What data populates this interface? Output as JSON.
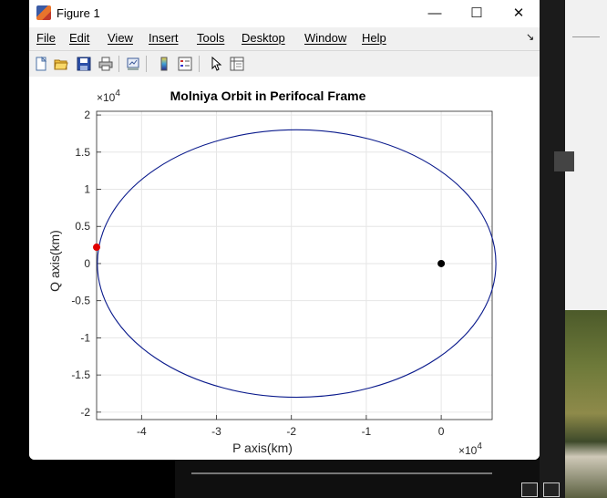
{
  "window": {
    "title": "Figure 1",
    "controls": {
      "minimize": "—",
      "maximize": "☐",
      "close": "✕"
    }
  },
  "menu": {
    "items": [
      "File",
      "Edit",
      "View",
      "Insert",
      "Tools",
      "Desktop",
      "Window",
      "Help"
    ],
    "overflow_arrow": "↘"
  },
  "toolbar": {
    "buttons": [
      "new-figure-icon",
      "open-file-icon",
      "save-icon",
      "print-icon",
      "link-plot-icon",
      "insert-colorbar-icon",
      "insert-legend-icon",
      "edit-plot-pointer-icon",
      "property-inspector-icon"
    ]
  },
  "chart_data": {
    "type": "line",
    "title": "Molniya Orbit in Perifocal Frame",
    "xlabel": "P axis(km)",
    "ylabel": "Q axis(km)",
    "x_multiplier": "×10",
    "x_exponent": "4",
    "y_multiplier": "×10",
    "y_exponent": "4",
    "xlim": [
      -46000,
      6800
    ],
    "ylim": [
      -21000,
      20500
    ],
    "xticks": [
      -4,
      -3,
      -2,
      -1,
      0
    ],
    "yticks": [
      2,
      1.5,
      1,
      0.5,
      0,
      -0.5,
      -1,
      -1.5,
      -2
    ],
    "grid": true,
    "series": [
      {
        "kind": "ellipse",
        "center_x": -19300,
        "semi_major_x": 26600,
        "semi_minor_y": 18000,
        "color": "#0a1a8c"
      }
    ],
    "markers": [
      {
        "x": 0,
        "y": 0,
        "color": "#000000"
      },
      {
        "x": -46000,
        "y": 2200,
        "color": "#e00000"
      }
    ]
  }
}
